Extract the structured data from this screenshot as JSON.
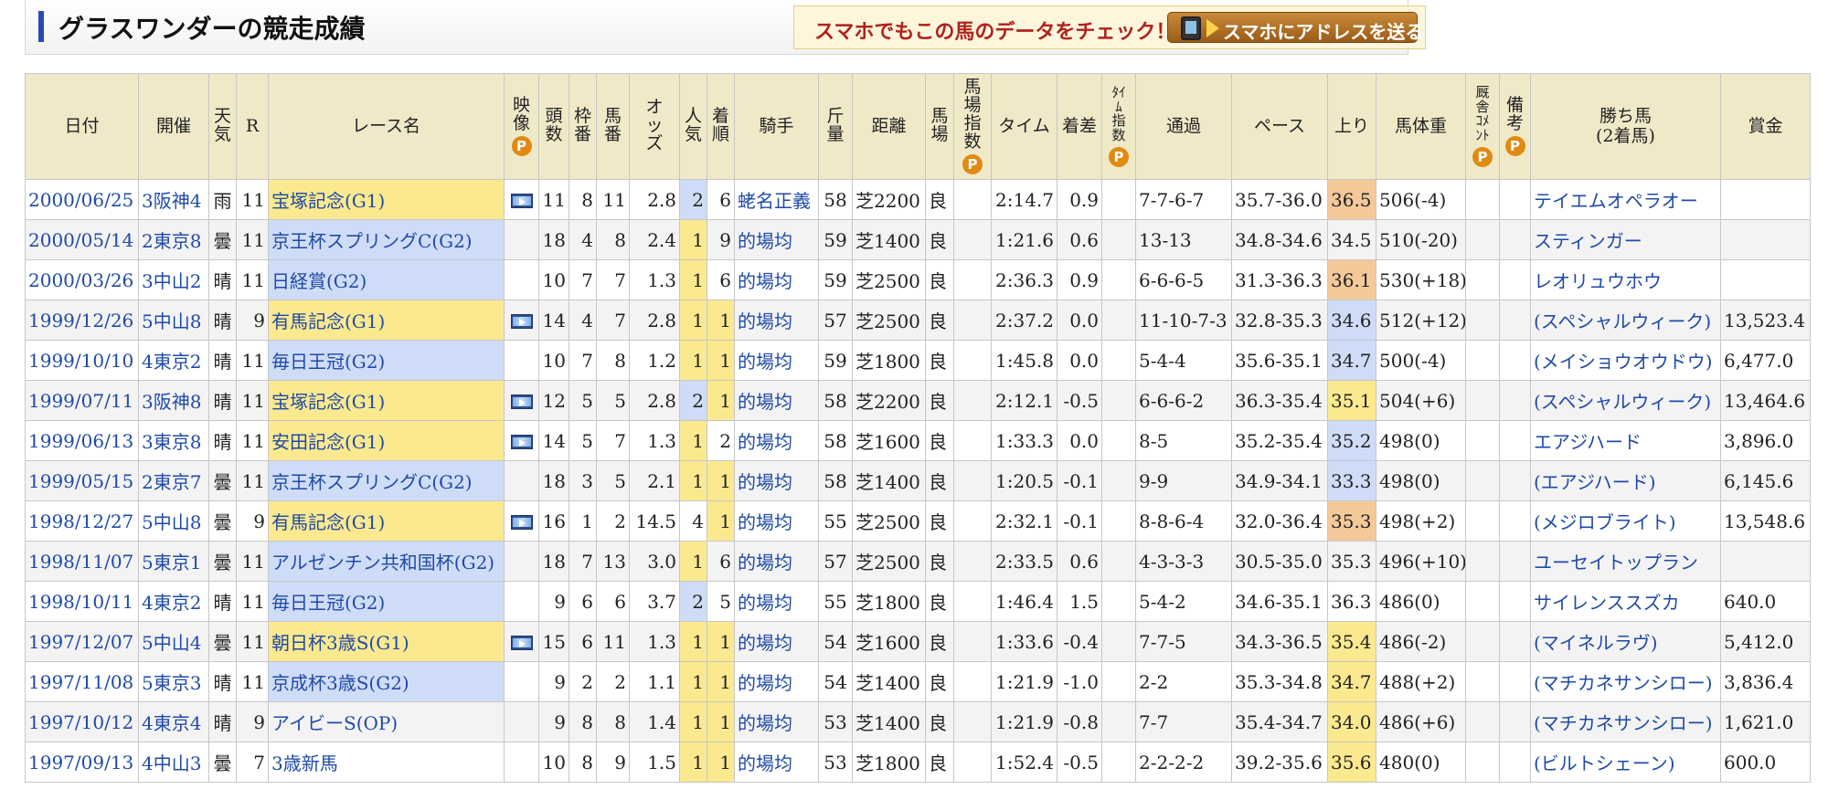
{
  "page": {
    "title": "グラスワンダーの競走成績",
    "promo_text": "スマホでもこの馬のデータをチェック！",
    "promo_button": "スマホにアドレスを送る"
  },
  "colors": {
    "header_bg": "#efe9c8",
    "g1_highlight": "#fbe98f",
    "g2_highlight": "#cfdcf7",
    "link": "#1f4aa8",
    "p_badge": "#e08a12"
  },
  "headers": {
    "date": "日付",
    "venue": "開催",
    "weather": "天気",
    "race_no": "R",
    "race_name": "レース名",
    "video": "映像",
    "runners": "頭数",
    "frame": "枠番",
    "horse_no": "馬番",
    "odds": "オッズ",
    "popularity": "人気",
    "finish": "着順",
    "jockey": "騎手",
    "weight_carried": "斤量",
    "distance": "距離",
    "track": "馬場",
    "track_index": "馬場指数",
    "time": "タイム",
    "margin": "着差",
    "time_index": "ﾀｲﾑ指数",
    "passing": "通過",
    "pace": "ペース",
    "last3f": "上り",
    "body_weight": "馬体重",
    "stable_comment": "厩舎ｺﾒﾝﾄ",
    "remarks": "備考",
    "winner_line1": "勝ち馬",
    "winner_line2": "(2着馬)",
    "prize": "賞金",
    "p_badge": "P"
  },
  "rows": [
    {
      "date": "2000/06/25",
      "venue": "3阪神4",
      "weather": "雨",
      "r": "11",
      "race": "宝塚記念(G1)",
      "grade": "g1",
      "video": true,
      "runners": "11",
      "frame": "8",
      "horse": "11",
      "odds": "2.8",
      "pop": "2",
      "finish": "6",
      "jockey": "蛯名正義",
      "kin": "58",
      "dist": "芝2200",
      "track": "良",
      "time": "2:14.7",
      "margin": "0.9",
      "passing": "7-7-6-7",
      "pace": "35.7-36.0",
      "up": "36.5",
      "up_hl": "orange",
      "weight": "506(-4)",
      "winner": "テイエムオペラオー",
      "prize": ""
    },
    {
      "date": "2000/05/14",
      "venue": "2東京8",
      "weather": "曇",
      "r": "11",
      "race": "京王杯スプリングC(G2)",
      "grade": "g2",
      "video": false,
      "runners": "18",
      "frame": "4",
      "horse": "8",
      "odds": "2.4",
      "pop": "1",
      "finish": "9",
      "jockey": "的場均",
      "kin": "59",
      "dist": "芝1400",
      "track": "良",
      "time": "1:21.6",
      "margin": "0.6",
      "passing": "13-13",
      "pace": "34.8-34.6",
      "up": "34.5",
      "up_hl": "",
      "weight": "510(-20)",
      "winner": "スティンガー",
      "prize": ""
    },
    {
      "date": "2000/03/26",
      "venue": "3中山2",
      "weather": "晴",
      "r": "11",
      "race": "日経賞(G2)",
      "grade": "g2",
      "video": false,
      "runners": "10",
      "frame": "7",
      "horse": "7",
      "odds": "1.3",
      "pop": "1",
      "finish": "6",
      "jockey": "的場均",
      "kin": "59",
      "dist": "芝2500",
      "track": "良",
      "time": "2:36.3",
      "margin": "0.9",
      "passing": "6-6-6-5",
      "pace": "31.3-36.3",
      "up": "36.1",
      "up_hl": "orange",
      "weight": "530(+18)",
      "winner": "レオリュウホウ",
      "prize": ""
    },
    {
      "date": "1999/12/26",
      "venue": "5中山8",
      "weather": "晴",
      "r": "9",
      "race": "有馬記念(G1)",
      "grade": "g1",
      "video": true,
      "runners": "14",
      "frame": "4",
      "horse": "7",
      "odds": "2.8",
      "pop": "1",
      "finish": "1",
      "jockey": "的場均",
      "kin": "57",
      "dist": "芝2500",
      "track": "良",
      "time": "2:37.2",
      "margin": "0.0",
      "passing": "11-10-7-3",
      "pace": "32.8-35.3",
      "up": "34.6",
      "up_hl": "blue",
      "weight": "512(+12)",
      "winner": "(スペシャルウィーク)",
      "prize": "13,523.4"
    },
    {
      "date": "1999/10/10",
      "venue": "4東京2",
      "weather": "晴",
      "r": "11",
      "race": "毎日王冠(G2)",
      "grade": "g2",
      "video": false,
      "runners": "10",
      "frame": "7",
      "horse": "8",
      "odds": "1.2",
      "pop": "1",
      "finish": "1",
      "jockey": "的場均",
      "kin": "59",
      "dist": "芝1800",
      "track": "良",
      "time": "1:45.8",
      "margin": "0.0",
      "passing": "5-4-4",
      "pace": "35.6-35.1",
      "up": "34.7",
      "up_hl": "blue",
      "weight": "500(-4)",
      "winner": "(メイショウオウドウ)",
      "prize": "6,477.0"
    },
    {
      "date": "1999/07/11",
      "venue": "3阪神8",
      "weather": "晴",
      "r": "11",
      "race": "宝塚記念(G1)",
      "grade": "g1",
      "video": true,
      "runners": "12",
      "frame": "5",
      "horse": "5",
      "odds": "2.8",
      "pop": "2",
      "finish": "1",
      "jockey": "的場均",
      "kin": "58",
      "dist": "芝2200",
      "track": "良",
      "time": "2:12.1",
      "margin": "-0.5",
      "passing": "6-6-6-2",
      "pace": "36.3-35.4",
      "up": "35.1",
      "up_hl": "yellow",
      "weight": "504(+6)",
      "winner": "(スペシャルウィーク)",
      "prize": "13,464.6"
    },
    {
      "date": "1999/06/13",
      "venue": "3東京8",
      "weather": "晴",
      "r": "11",
      "race": "安田記念(G1)",
      "grade": "g1",
      "video": true,
      "runners": "14",
      "frame": "5",
      "horse": "7",
      "odds": "1.3",
      "pop": "1",
      "finish": "2",
      "jockey": "的場均",
      "kin": "58",
      "dist": "芝1600",
      "track": "良",
      "time": "1:33.3",
      "margin": "0.0",
      "passing": "8-5",
      "pace": "35.2-35.4",
      "up": "35.2",
      "up_hl": "blue",
      "weight": "498(0)",
      "winner": "エアジハード",
      "prize": "3,896.0"
    },
    {
      "date": "1999/05/15",
      "venue": "2東京7",
      "weather": "曇",
      "r": "11",
      "race": "京王杯スプリングC(G2)",
      "grade": "g2",
      "video": false,
      "runners": "18",
      "frame": "3",
      "horse": "5",
      "odds": "2.1",
      "pop": "1",
      "finish": "1",
      "jockey": "的場均",
      "kin": "58",
      "dist": "芝1400",
      "track": "良",
      "time": "1:20.5",
      "margin": "-0.1",
      "passing": "9-9",
      "pace": "34.9-34.1",
      "up": "33.3",
      "up_hl": "blue",
      "weight": "498(0)",
      "winner": "(エアジハード)",
      "prize": "6,145.6"
    },
    {
      "date": "1998/12/27",
      "venue": "5中山8",
      "weather": "曇",
      "r": "9",
      "race": "有馬記念(G1)",
      "grade": "g1",
      "video": true,
      "runners": "16",
      "frame": "1",
      "horse": "2",
      "odds": "14.5",
      "pop": "4",
      "finish": "1",
      "jockey": "的場均",
      "kin": "55",
      "dist": "芝2500",
      "track": "良",
      "time": "2:32.1",
      "margin": "-0.1",
      "passing": "8-8-6-4",
      "pace": "32.0-36.4",
      "up": "35.3",
      "up_hl": "orange",
      "weight": "498(+2)",
      "winner": "(メジロブライト)",
      "prize": "13,548.6"
    },
    {
      "date": "1998/11/07",
      "venue": "5東京1",
      "weather": "曇",
      "r": "11",
      "race": "アルゼンチン共和国杯(G2)",
      "grade": "g2",
      "video": false,
      "runners": "18",
      "frame": "7",
      "horse": "13",
      "odds": "3.0",
      "pop": "1",
      "finish": "6",
      "jockey": "的場均",
      "kin": "57",
      "dist": "芝2500",
      "track": "良",
      "time": "2:33.5",
      "margin": "0.6",
      "passing": "4-3-3-3",
      "pace": "30.5-35.0",
      "up": "35.3",
      "up_hl": "",
      "weight": "496(+10)",
      "winner": "ユーセイトップラン",
      "prize": ""
    },
    {
      "date": "1998/10/11",
      "venue": "4東京2",
      "weather": "晴",
      "r": "11",
      "race": "毎日王冠(G2)",
      "grade": "g2",
      "video": false,
      "runners": "9",
      "frame": "6",
      "horse": "6",
      "odds": "3.7",
      "pop": "2",
      "finish": "5",
      "jockey": "的場均",
      "kin": "55",
      "dist": "芝1800",
      "track": "良",
      "time": "1:46.4",
      "margin": "1.5",
      "passing": "5-4-2",
      "pace": "34.6-35.1",
      "up": "36.3",
      "up_hl": "",
      "weight": "486(0)",
      "winner": "サイレンススズカ",
      "prize": "640.0"
    },
    {
      "date": "1997/12/07",
      "venue": "5中山4",
      "weather": "曇",
      "r": "11",
      "race": "朝日杯3歳S(G1)",
      "grade": "g1",
      "video": true,
      "runners": "15",
      "frame": "6",
      "horse": "11",
      "odds": "1.3",
      "pop": "1",
      "finish": "1",
      "jockey": "的場均",
      "kin": "54",
      "dist": "芝1600",
      "track": "良",
      "time": "1:33.6",
      "margin": "-0.4",
      "passing": "7-7-5",
      "pace": "34.3-36.5",
      "up": "35.4",
      "up_hl": "yellow",
      "weight": "486(-2)",
      "winner": "(マイネルラヴ)",
      "prize": "5,412.0"
    },
    {
      "date": "1997/11/08",
      "venue": "5東京3",
      "weather": "晴",
      "r": "11",
      "race": "京成杯3歳S(G2)",
      "grade": "g2",
      "video": false,
      "runners": "9",
      "frame": "2",
      "horse": "2",
      "odds": "1.1",
      "pop": "1",
      "finish": "1",
      "jockey": "的場均",
      "kin": "54",
      "dist": "芝1400",
      "track": "良",
      "time": "1:21.9",
      "margin": "-1.0",
      "passing": "2-2",
      "pace": "35.3-34.8",
      "up": "34.7",
      "up_hl": "yellow",
      "weight": "488(+2)",
      "winner": "(マチカネサンシロー)",
      "prize": "3,836.4"
    },
    {
      "date": "1997/10/12",
      "venue": "4東京4",
      "weather": "晴",
      "r": "9",
      "race": "アイビーS(OP)",
      "grade": "",
      "video": false,
      "runners": "9",
      "frame": "8",
      "horse": "8",
      "odds": "1.4",
      "pop": "1",
      "finish": "1",
      "jockey": "的場均",
      "kin": "53",
      "dist": "芝1400",
      "track": "良",
      "time": "1:21.9",
      "margin": "-0.8",
      "passing": "7-7",
      "pace": "35.4-34.7",
      "up": "34.0",
      "up_hl": "yellow",
      "weight": "486(+6)",
      "winner": "(マチカネサンシロー)",
      "prize": "1,621.0"
    },
    {
      "date": "1997/09/13",
      "venue": "4中山3",
      "weather": "曇",
      "r": "7",
      "race": "3歳新馬",
      "grade": "",
      "video": false,
      "runners": "10",
      "frame": "8",
      "horse": "9",
      "odds": "1.5",
      "pop": "1",
      "finish": "1",
      "jockey": "的場均",
      "kin": "53",
      "dist": "芝1800",
      "track": "良",
      "time": "1:52.4",
      "margin": "-0.5",
      "passing": "2-2-2-2",
      "pace": "39.2-35.6",
      "up": "35.6",
      "up_hl": "yellow",
      "weight": "480(0)",
      "winner": "(ビルトシェーン)",
      "prize": "600.0"
    }
  ]
}
